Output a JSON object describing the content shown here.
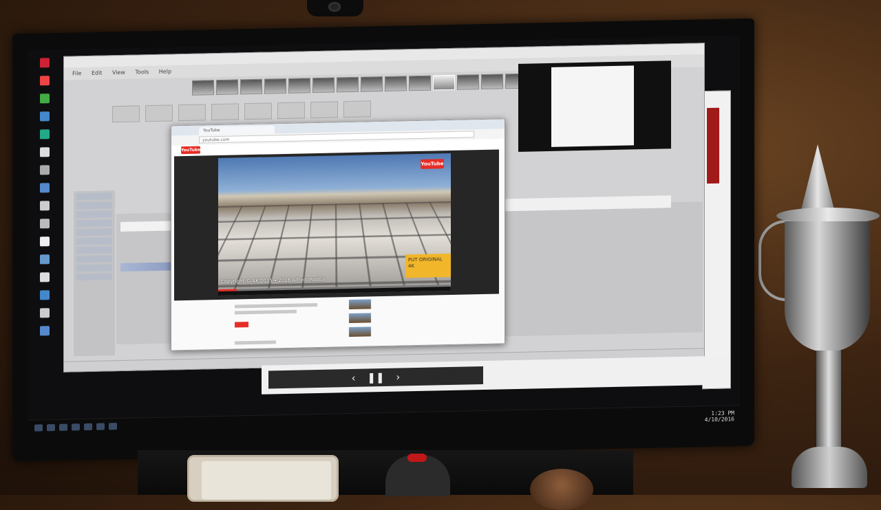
{
  "scene": {
    "description_colors": {
      "wall": "#3d2412",
      "bezel": "#0b0b0b",
      "youtube_red": "#e52d27",
      "badge_yellow": "#f2b62a"
    }
  },
  "editor": {
    "menu": [
      "File",
      "Edit",
      "View",
      "Tools",
      "Help"
    ],
    "filmstrip_count": 14,
    "selected_thumb_index": 10
  },
  "browser": {
    "tab_title": "YouTube",
    "url": "youtube.com",
    "logo_text": "YouTube"
  },
  "video": {
    "watermark": "YouTube",
    "badge_text": "PUT ORIGINAL 4K",
    "caption": "Copyright © 4K 2015 • 2016 AlfredoPadilla",
    "progress_fraction": 0.08
  },
  "slideshow": {
    "prev": "‹",
    "pause": "❚❚",
    "next": "›"
  },
  "taskbar": {
    "time": "1:23 PM",
    "date": "4/10/2016"
  },
  "icons": [
    "recycle-bin-icon",
    "folder-icon",
    "app-icon",
    "play-icon",
    "pause-icon",
    "chevron-left-icon",
    "chevron-right-icon"
  ]
}
